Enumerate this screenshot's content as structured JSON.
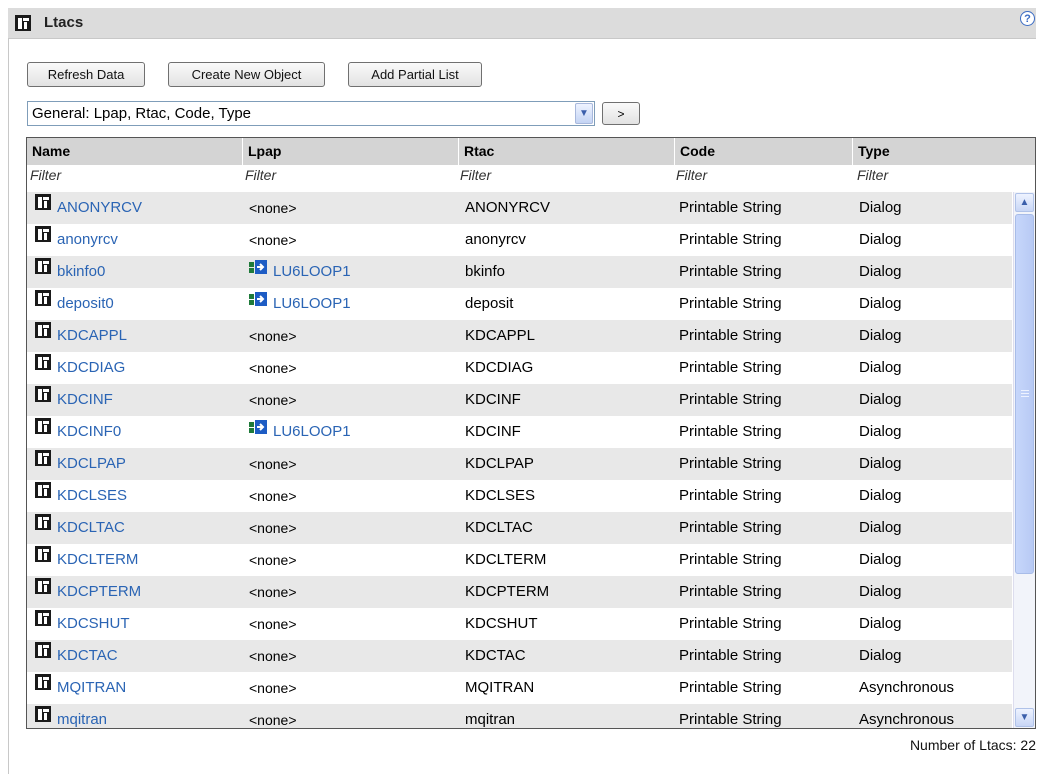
{
  "window": {
    "title": "Ltacs",
    "help_label": "?"
  },
  "toolbar": {
    "refresh_label": "Refresh Data",
    "create_label": "Create New Object",
    "partial_label": "Add Partial List"
  },
  "view_select": {
    "selected": "General: Lpap, Rtac, Code, Type",
    "go_label": ">"
  },
  "table": {
    "columns": [
      "Name",
      "Lpap",
      "Rtac",
      "Code",
      "Type"
    ],
    "filter_placeholder": "Filter",
    "rows": [
      {
        "name": "ANONYRCV",
        "lpap": "<none>",
        "rtac": "ANONYRCV",
        "code": "Printable String",
        "type": "Dialog"
      },
      {
        "name": "anonyrcv",
        "lpap": "<none>",
        "rtac": "anonyrcv",
        "code": "Printable String",
        "type": "Dialog"
      },
      {
        "name": "bkinfo0",
        "lpap": "LU6LOOP1",
        "rtac": "bkinfo",
        "code": "Printable String",
        "type": "Dialog"
      },
      {
        "name": "deposit0",
        "lpap": "LU6LOOP1",
        "rtac": "deposit",
        "code": "Printable String",
        "type": "Dialog"
      },
      {
        "name": "KDCAPPL",
        "lpap": "<none>",
        "rtac": "KDCAPPL",
        "code": "Printable String",
        "type": "Dialog"
      },
      {
        "name": "KDCDIAG",
        "lpap": "<none>",
        "rtac": "KDCDIAG",
        "code": "Printable String",
        "type": "Dialog"
      },
      {
        "name": "KDCINF",
        "lpap": "<none>",
        "rtac": "KDCINF",
        "code": "Printable String",
        "type": "Dialog"
      },
      {
        "name": "KDCINF0",
        "lpap": "LU6LOOP1",
        "rtac": "KDCINF",
        "code": "Printable String",
        "type": "Dialog"
      },
      {
        "name": "KDCLPAP",
        "lpap": "<none>",
        "rtac": "KDCLPAP",
        "code": "Printable String",
        "type": "Dialog"
      },
      {
        "name": "KDCLSES",
        "lpap": "<none>",
        "rtac": "KDCLSES",
        "code": "Printable String",
        "type": "Dialog"
      },
      {
        "name": "KDCLTAC",
        "lpap": "<none>",
        "rtac": "KDCLTAC",
        "code": "Printable String",
        "type": "Dialog"
      },
      {
        "name": "KDCLTERM",
        "lpap": "<none>",
        "rtac": "KDCLTERM",
        "code": "Printable String",
        "type": "Dialog"
      },
      {
        "name": "KDCPTERM",
        "lpap": "<none>",
        "rtac": "KDCPTERM",
        "code": "Printable String",
        "type": "Dialog"
      },
      {
        "name": "KDCSHUT",
        "lpap": "<none>",
        "rtac": "KDCSHUT",
        "code": "Printable String",
        "type": "Dialog"
      },
      {
        "name": "KDCTAC",
        "lpap": "<none>",
        "rtac": "KDCTAC",
        "code": "Printable String",
        "type": "Dialog"
      },
      {
        "name": "MQITRAN",
        "lpap": "<none>",
        "rtac": "MQITRAN",
        "code": "Printable String",
        "type": "Asynchronous"
      },
      {
        "name": "mqitran",
        "lpap": "<none>",
        "rtac": "mqitran",
        "code": "Printable String",
        "type": "Asynchronous"
      }
    ]
  },
  "footer": {
    "count_text": "Number of Ltacs:  22"
  }
}
